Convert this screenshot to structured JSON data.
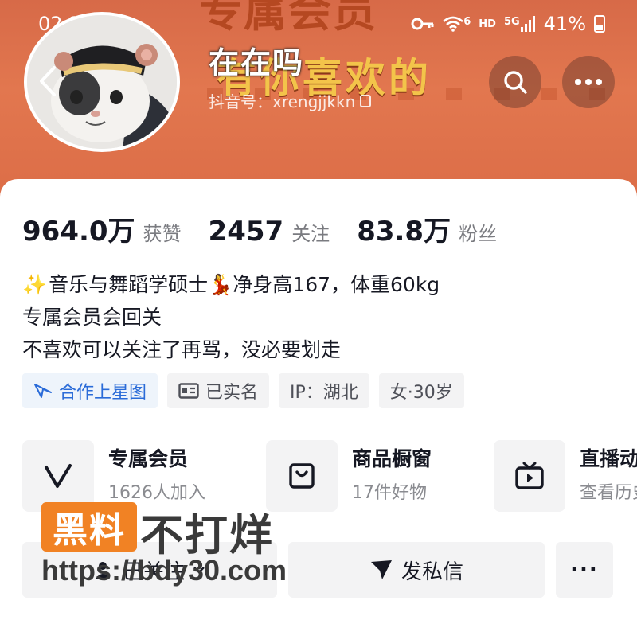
{
  "status_bar": {
    "time": "02:20",
    "network_5g": "5G",
    "network_hd": "HD",
    "wifi_badge": "6",
    "battery": "41%"
  },
  "header": {
    "banner_decor_text": "专属会员",
    "banner_text": "有你喜欢的",
    "nickname": "在在吗",
    "douyin_id": "抖音号：xrengjjkkn"
  },
  "stats": [
    {
      "value": "964.0万",
      "label": "获赞"
    },
    {
      "value": "2457",
      "label": "关注"
    },
    {
      "value": "83.8万",
      "label": "粉丝"
    }
  ],
  "bio": {
    "line1": "音乐与舞蹈学硕士",
    "line1b": "净身高167，体重60kg",
    "line2": "专属会员会回关",
    "line3": "不喜欢可以关注了再骂，没必要划走"
  },
  "tags": {
    "star_map": "合作上星图",
    "verified": "已实名",
    "ip": "IP：湖北",
    "gender_age": "女·30岁"
  },
  "features": {
    "membership": {
      "title": "专属会员",
      "sub": "1626人加入"
    },
    "shop": {
      "title": "商品橱窗",
      "sub": "17件好物"
    },
    "live": {
      "title": "直播动态",
      "sub": "查看历史"
    }
  },
  "actions": {
    "follow": "已关注",
    "message": "发私信",
    "more": "···"
  },
  "watermark": {
    "badge": "黑料",
    "text": "不打烊",
    "url": "https://bdy30.com"
  },
  "colors": {
    "banner": "#e2774f",
    "accent_blue": "#2a6bd8",
    "watermark_orange": "#f18224"
  }
}
